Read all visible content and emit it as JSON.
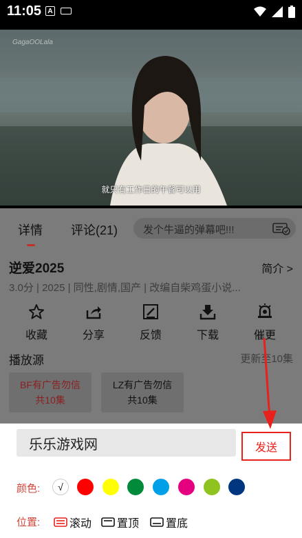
{
  "status_bar": {
    "time": "11:05",
    "a_badge": "A"
  },
  "video": {
    "watermark": "GagaOOLala",
    "subtitle": "就只有工作日的午餐可以用"
  },
  "tabs": [
    {
      "label": "详情"
    },
    {
      "label": "评论(21)"
    }
  ],
  "danmu": {
    "placeholder": "发个牛逼的弹幕吧!!!"
  },
  "drama": {
    "title": "逆爱2025",
    "intro": "简介 >",
    "meta": "3.0分  | 2025  |  同性,剧情,国产  |  改编自柴鸡蛋小说..."
  },
  "actions": [
    {
      "label": "收藏",
      "icon": "star-icon"
    },
    {
      "label": "分享",
      "icon": "share-icon"
    },
    {
      "label": "反馈",
      "icon": "feedback-icon"
    },
    {
      "label": "下载",
      "icon": "download-icon"
    },
    {
      "label": "催更",
      "icon": "bell-icon"
    }
  ],
  "sources": {
    "title": "播放源",
    "update": "更新至10集",
    "items": [
      {
        "line1": "BF有广告勿信",
        "line2": "共10集"
      },
      {
        "line1": "LZ有广告勿信",
        "line2": "共10集"
      }
    ]
  },
  "sheet": {
    "input_value": "乐乐游戏网",
    "send_label": "发送",
    "color_label": "颜色:",
    "selected_mark": "√",
    "colors": [
      "#ffffff",
      "#ff0000",
      "#ffff00",
      "#008a3a",
      "#00a0e9",
      "#e4007f",
      "#8fc31f",
      "#003580"
    ],
    "position_label": "位置:",
    "positions": [
      "滚动",
      "置顶",
      "置底"
    ]
  },
  "accent_color": "#e8211c"
}
